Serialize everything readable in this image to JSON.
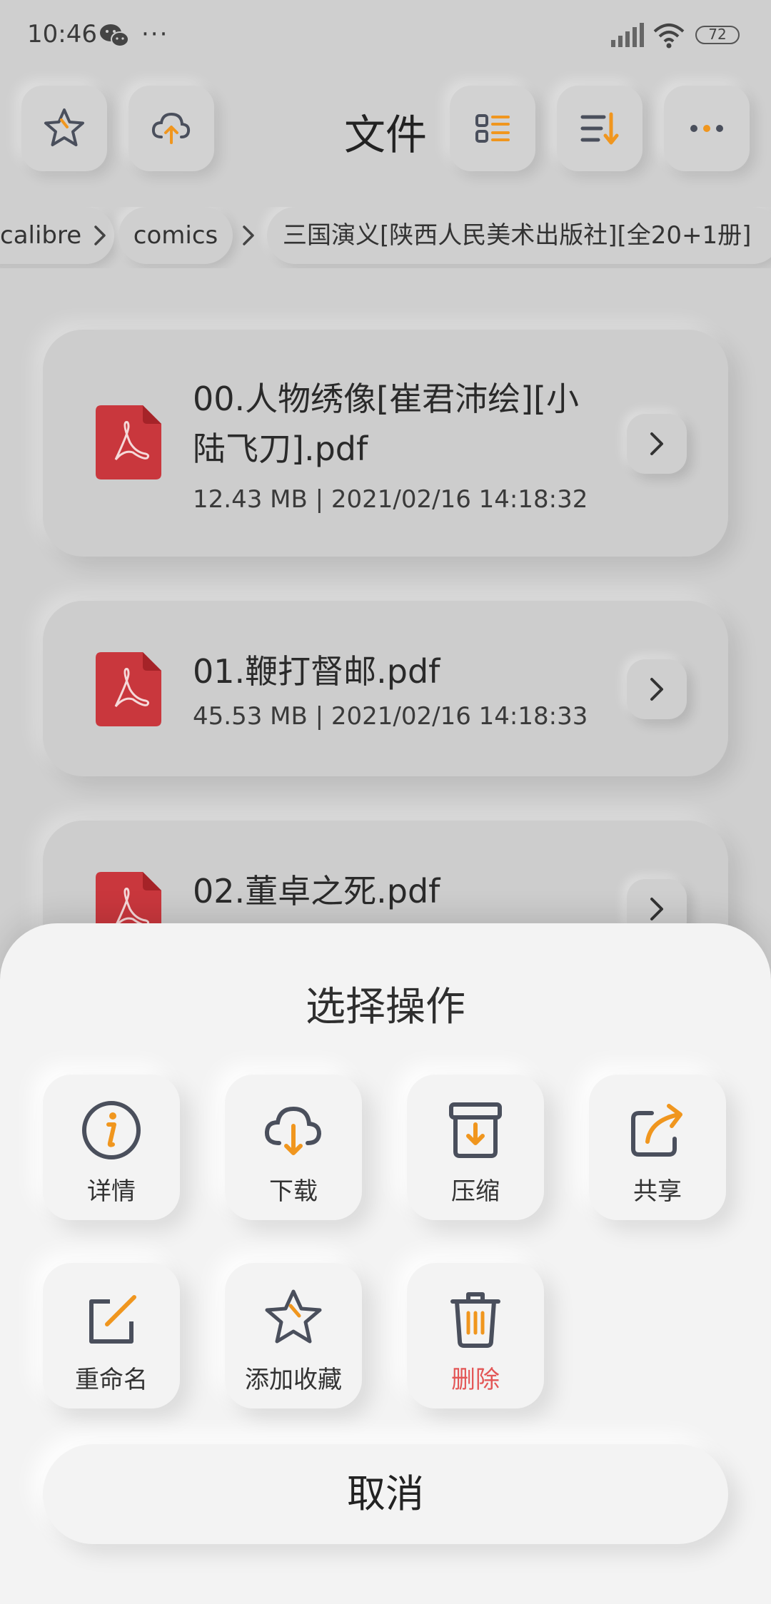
{
  "status_bar": {
    "time": "10:46",
    "more": "···",
    "battery": "72"
  },
  "header": {
    "title": "文件",
    "buttons": [
      "star-icon",
      "cloud-upload-icon",
      "list-view-icon",
      "sort-icon",
      "more-icon"
    ]
  },
  "breadcrumb": {
    "items": [
      "calibre",
      "comics",
      "三国演义[陕西人民美术出版社][全20+1册]"
    ]
  },
  "files": [
    {
      "name": "00.人物绣像[崔君沛绘][小陆飞刀].pdf",
      "name_line1": "00.人物绣像[崔君沛绘][小",
      "name_line2": "陆飞刀].pdf",
      "meta": "12.43 MB | 2021/02/16 14:18:32"
    },
    {
      "name": "01.鞭打督邮.pdf",
      "meta": "45.53 MB | 2021/02/16 14:18:33"
    },
    {
      "name": "02.董卓之死.pdf"
    }
  ],
  "sheet": {
    "title": "选择操作",
    "actions": [
      {
        "label": "详情",
        "icon": "info-icon"
      },
      {
        "label": "下载",
        "icon": "cloud-download-icon"
      },
      {
        "label": "压缩",
        "icon": "archive-icon"
      },
      {
        "label": "共享",
        "icon": "share-icon"
      },
      {
        "label": "重命名",
        "icon": "rename-icon"
      },
      {
        "label": "添加收藏",
        "icon": "star-icon"
      },
      {
        "label": "删除",
        "icon": "trash-icon"
      }
    ],
    "cancel": "取消"
  },
  "colors": {
    "accent": "#f0961e",
    "icon_dark": "#4a4f5c",
    "pdf_red": "#c9373d",
    "danger": "#e35656"
  }
}
